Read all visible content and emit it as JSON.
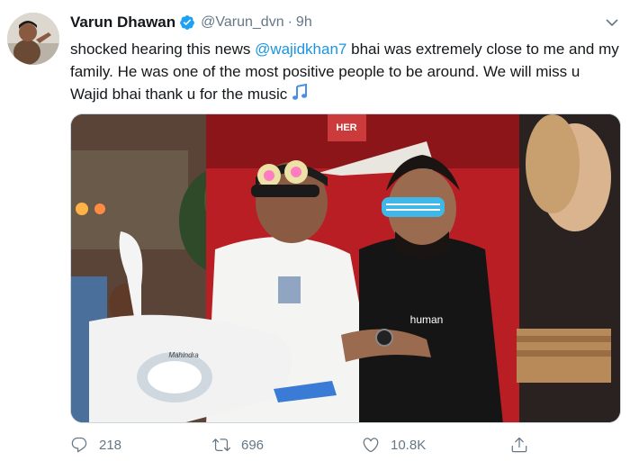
{
  "tweet": {
    "author": {
      "display_name": "Varun Dhawan",
      "handle": "@Varun_dvn",
      "separator": "·",
      "time": "9h",
      "verified": true
    },
    "text": {
      "part1": "shocked hearing this news ",
      "mention": "@wajidkhan7",
      "part2": " bhai was extremely close to me and my family. He was one of the most positive people to be around. We will miss u Wajid bhai thank u for the music"
    },
    "media": {
      "sign_text": "HER",
      "shirt_text": "human",
      "scooter_brand": "Mahindra"
    },
    "actions": {
      "replies": "218",
      "retweets": "696",
      "likes": "10.8K"
    },
    "colors": {
      "link": "#1b95e0",
      "secondary": "#657786",
      "verified": "#1da1f2"
    },
    "icons": [
      "verified-badge-icon",
      "chevron-down-icon",
      "music-note-icon",
      "reply-icon",
      "retweet-icon",
      "like-icon",
      "share-icon"
    ]
  }
}
